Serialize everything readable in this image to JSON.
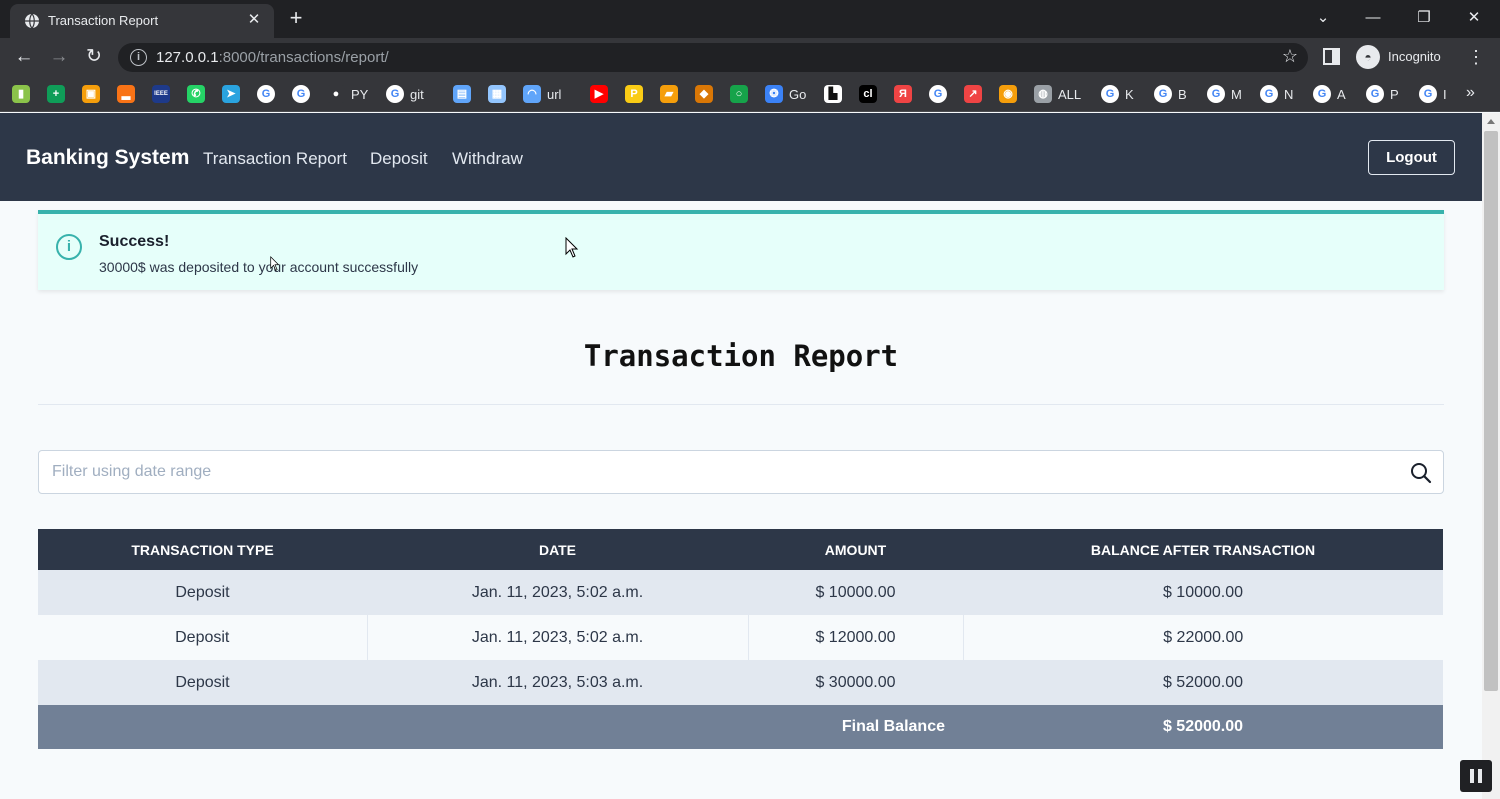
{
  "browser": {
    "tab_title": "Transaction Report",
    "tab_close": "✕",
    "new_tab": "+",
    "url_host": "127.0.0.1",
    "url_path": ":8000/transactions/report/",
    "incognito_label": "Incognito",
    "bookmarks": [
      {
        "icon": "green-leaf-icon",
        "label": "",
        "color": "#8bc34a",
        "glyph": "▮"
      },
      {
        "icon": "sheets-plus-icon",
        "label": "",
        "color": "#0f9d58",
        "glyph": "+"
      },
      {
        "icon": "orange-app-icon",
        "label": "",
        "color": "#f59e0b",
        "glyph": "▣"
      },
      {
        "icon": "bar-chart-icon",
        "label": "",
        "color": "#f97316",
        "glyph": "▂"
      },
      {
        "icon": "ieee-icon",
        "label": "",
        "color": "#1e3a8a",
        "glyph": "IEEE"
      },
      {
        "icon": "whatsapp-icon",
        "label": "",
        "color": "#25d366",
        "glyph": "✆"
      },
      {
        "icon": "telegram-icon",
        "label": "",
        "color": "#2aa3df",
        "glyph": "➤"
      },
      {
        "icon": "google-icon",
        "label": "",
        "color": "#ffffff",
        "glyph": "G"
      },
      {
        "icon": "google-icon",
        "label": "",
        "color": "#ffffff",
        "glyph": "G"
      },
      {
        "icon": "github-icon",
        "label": "PY",
        "color": "#35363a",
        "glyph": "●"
      },
      {
        "icon": "google-icon",
        "label": "git",
        "color": "#ffffff",
        "glyph": "G"
      },
      {
        "icon": "blue-page-icon",
        "label": "",
        "color": "#60a5fa",
        "glyph": "▤"
      },
      {
        "icon": "store-icon",
        "label": "",
        "color": "#93c5fd",
        "glyph": "▦"
      },
      {
        "icon": "wifi-page-icon",
        "label": "url",
        "color": "#60a5fa",
        "glyph": "◠"
      },
      {
        "icon": "youtube-icon",
        "label": "",
        "color": "#ff0000",
        "glyph": "▶"
      },
      {
        "icon": "p-icon",
        "label": "",
        "color": "#facc15",
        "glyph": "P"
      },
      {
        "icon": "film-icon",
        "label": "",
        "color": "#f59e0b",
        "glyph": "▰"
      },
      {
        "icon": "cart-icon",
        "label": "",
        "color": "#d97706",
        "glyph": "◆"
      },
      {
        "icon": "green-ring-icon",
        "label": "",
        "color": "#16a34a",
        "glyph": "○"
      },
      {
        "icon": "gemini-icon",
        "label": "Go",
        "color": "#3b82f6",
        "glyph": "❂"
      },
      {
        "icon": "white-doc-icon",
        "label": "",
        "color": "#ffffff",
        "glyph": "▙"
      },
      {
        "icon": "cl-icon",
        "label": "",
        "color": "#000000",
        "glyph": "cl"
      },
      {
        "icon": "yandex-icon",
        "label": "",
        "color": "#ef4444",
        "glyph": "Я"
      },
      {
        "icon": "google-icon",
        "label": "",
        "color": "#ffffff",
        "glyph": "G"
      },
      {
        "icon": "arrow-icon",
        "label": "",
        "color": "#ef4444",
        "glyph": "↗"
      },
      {
        "icon": "eye-icon",
        "label": "",
        "color": "#f59e0b",
        "glyph": "◉"
      },
      {
        "icon": "globe-icon",
        "label": "ALL",
        "color": "#9aa0a6",
        "glyph": "◍"
      },
      {
        "icon": "google-icon",
        "label": "K",
        "color": "#ffffff",
        "glyph": "G"
      },
      {
        "icon": "google-icon",
        "label": "B",
        "color": "#ffffff",
        "glyph": "G"
      },
      {
        "icon": "google-icon",
        "label": "M",
        "color": "#ffffff",
        "glyph": "G"
      },
      {
        "icon": "google-icon",
        "label": "N",
        "color": "#ffffff",
        "glyph": "G"
      },
      {
        "icon": "google-icon",
        "label": "A",
        "color": "#ffffff",
        "glyph": "G"
      },
      {
        "icon": "google-icon",
        "label": "P",
        "color": "#ffffff",
        "glyph": "G"
      },
      {
        "icon": "google-icon",
        "label": "I",
        "color": "#ffffff",
        "glyph": "G"
      }
    ],
    "bookmarks_more": "»"
  },
  "navbar": {
    "brand": "Banking System",
    "links": [
      "Transaction Report",
      "Deposit",
      "Withdraw"
    ],
    "logout_label": "Logout"
  },
  "alert": {
    "icon": "info-icon",
    "title": "Success!",
    "message": "30000$ was deposited to your account successfully"
  },
  "report": {
    "title": "Transaction Report"
  },
  "search": {
    "placeholder": "Filter using date range",
    "value": ""
  },
  "table": {
    "headers": [
      "TRANSACTION TYPE",
      "DATE",
      "AMOUNT",
      "BALANCE AFTER TRANSACTION"
    ],
    "rows": [
      {
        "type": "Deposit",
        "date": "Jan. 11, 2023, 5:02 a.m.",
        "amount": "$ 10000.00",
        "balance": "$ 10000.00"
      },
      {
        "type": "Deposit",
        "date": "Jan. 11, 2023, 5:02 a.m.",
        "amount": "$ 12000.00",
        "balance": "$ 22000.00"
      },
      {
        "type": "Deposit",
        "date": "Jan. 11, 2023, 5:03 a.m.",
        "amount": "$ 30000.00",
        "balance": "$ 52000.00"
      }
    ],
    "footer_label": "Final Balance",
    "footer_value": "$ 52000.00"
  },
  "colors": {
    "navbar_bg": "#2d3748",
    "alert_bg": "#e6fffa",
    "alert_accent": "#38b2ac",
    "table_footer_bg": "#718096"
  }
}
